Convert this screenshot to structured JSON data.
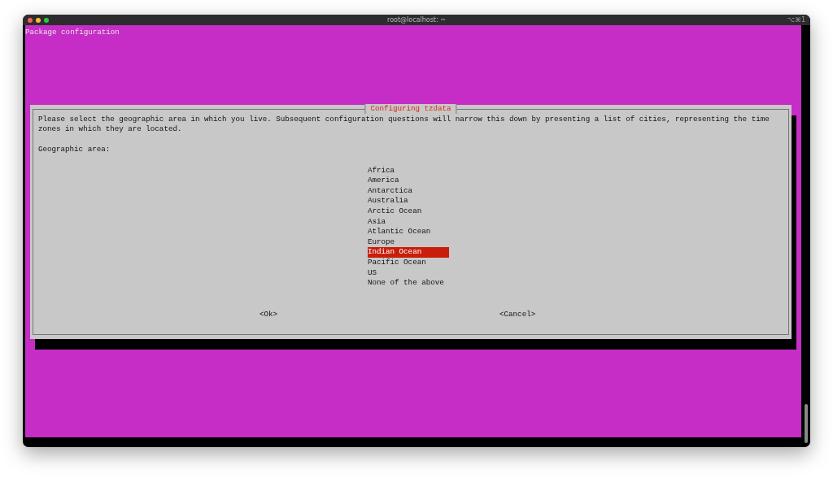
{
  "window": {
    "title": "root@localhost: ~",
    "shortcut": "⌥⌘1"
  },
  "header": "Package configuration",
  "dialog": {
    "title": "Configuring tzdata",
    "description": "Please select the geographic area in which you live. Subsequent configuration questions will narrow this down by presenting a list of cities, representing the time zones in which they are located.",
    "prompt": "Geographic area:",
    "options": [
      {
        "label": "Africa",
        "selected": false
      },
      {
        "label": "America",
        "selected": false
      },
      {
        "label": "Antarctica",
        "selected": false
      },
      {
        "label": "Australia",
        "selected": false
      },
      {
        "label": "Arctic Ocean",
        "selected": false
      },
      {
        "label": "Asia",
        "selected": false
      },
      {
        "label": "Atlantic Ocean",
        "selected": false
      },
      {
        "label": "Europe",
        "selected": false
      },
      {
        "label": "Indian Ocean",
        "selected": true
      },
      {
        "label": "Pacific Ocean",
        "selected": false
      },
      {
        "label": "US",
        "selected": false
      },
      {
        "label": "None of the above",
        "selected": false
      }
    ],
    "buttons": [
      "<Ok>",
      "<Cancel>"
    ]
  }
}
